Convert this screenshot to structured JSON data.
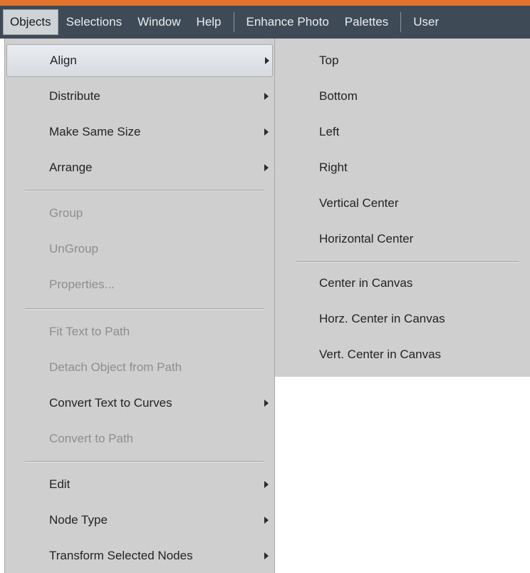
{
  "menubar": {
    "items": [
      {
        "label": "Objects"
      },
      {
        "label": "Selections"
      },
      {
        "label": "Window"
      },
      {
        "label": "Help"
      },
      {
        "label": "Enhance Photo"
      },
      {
        "label": "Palettes"
      },
      {
        "label": "User"
      }
    ]
  },
  "objects_menu": {
    "items": [
      {
        "label": "Align",
        "state": "highlighted",
        "submenu": true
      },
      {
        "label": "Distribute",
        "submenu": true
      },
      {
        "label": "Make Same Size",
        "submenu": true
      },
      {
        "label": "Arrange",
        "submenu": true
      },
      {
        "label": "Group",
        "disabled": true
      },
      {
        "label": "UnGroup",
        "disabled": true
      },
      {
        "label": "Properties...",
        "disabled": true
      },
      {
        "label": "Fit Text to Path",
        "disabled": true
      },
      {
        "label": "Detach Object from Path",
        "disabled": true
      },
      {
        "label": "Convert Text to Curves",
        "submenu": true
      },
      {
        "label": "Convert to Path",
        "disabled": true
      },
      {
        "label": "Edit",
        "submenu": true
      },
      {
        "label": "Node Type",
        "submenu": true
      },
      {
        "label": "Transform Selected Nodes",
        "submenu": true
      }
    ]
  },
  "align_submenu": {
    "items": [
      {
        "label": "Top"
      },
      {
        "label": "Bottom"
      },
      {
        "label": "Left"
      },
      {
        "label": "Right"
      },
      {
        "label": "Vertical Center"
      },
      {
        "label": "Horizontal Center"
      },
      {
        "label": "Center in Canvas"
      },
      {
        "label": "Horz. Center in Canvas"
      },
      {
        "label": "Vert. Center in Canvas"
      }
    ]
  },
  "colors": {
    "accent_strip": "#e2732d",
    "menubar_bg": "#3e4a55",
    "menu_bg": "#cfcfcf",
    "disabled_text": "#8e8e8e"
  }
}
